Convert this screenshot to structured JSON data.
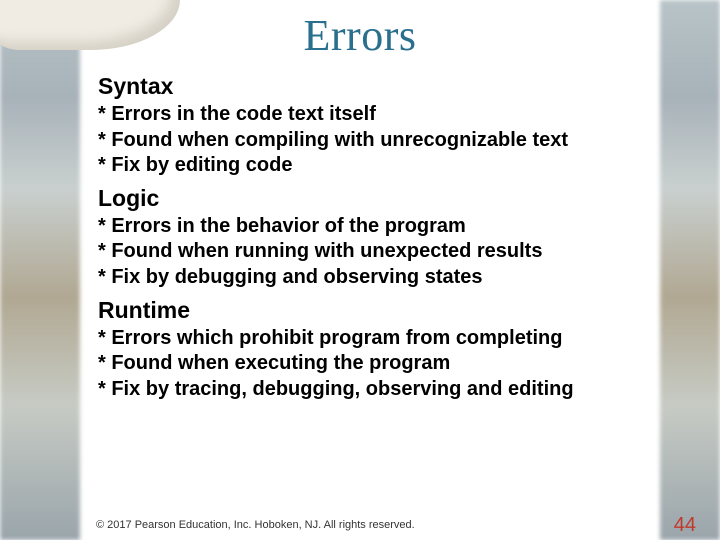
{
  "title": "Errors",
  "sections": [
    {
      "heading": "Syntax",
      "bullets": [
        "* Errors in the code text itself",
        "* Found when compiling with unrecognizable text",
        "* Fix by editing code"
      ]
    },
    {
      "heading": "Logic",
      "bullets": [
        "* Errors in the behavior of the program",
        "* Found when running with unexpected results",
        "* Fix by debugging and observing states"
      ]
    },
    {
      "heading": "Runtime",
      "bullets": [
        "* Errors which prohibit program from completing",
        "* Found when executing the program",
        "* Fix by tracing, debugging, observing and editing"
      ]
    }
  ],
  "footer": {
    "copyright": "© 2017 Pearson Education, Inc. Hoboken, NJ. All rights reserved.",
    "page": "44"
  }
}
